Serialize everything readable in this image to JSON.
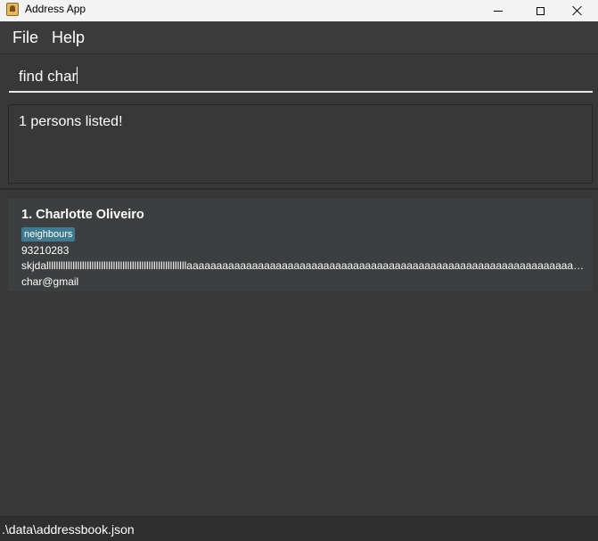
{
  "window": {
    "title": "Address App",
    "icon": "address-book-icon"
  },
  "menu": {
    "items": [
      "File",
      "Help"
    ]
  },
  "command": {
    "value": "find char"
  },
  "result": {
    "message": "1 persons listed!"
  },
  "persons": [
    {
      "index_name": "1. Charlotte Oliveiro",
      "tags": [
        "neighbours"
      ],
      "phone": "93210283",
      "address": "skjdalllllllllllllllllllllllllllllllllllllllllllllllllllllllllllaaaaaaaaaaaaaaaaaaaaaaaaaaaaaaaaaaaaaaaaaaaaaaaaaaaaaaaaaaaaaaaaaaaaaaaaaaaaaa",
      "email": "char@gmail"
    }
  ],
  "status": {
    "path": ".\\data\\addressbook.json"
  },
  "colors": {
    "background": "#383838",
    "tag": "#3e7b91",
    "card": "#3c3e3f"
  }
}
